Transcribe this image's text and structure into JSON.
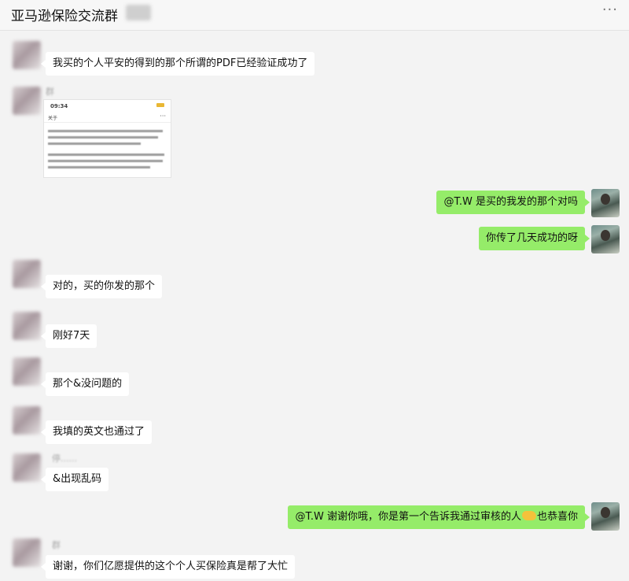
{
  "header": {
    "title": "亚马逊保险交流群",
    "more_icon": "more-icon"
  },
  "messages": {
    "m1": {
      "text": "我买的个人平安的得到的那个所谓的PDF已经验证成功了"
    },
    "m2": {
      "nick": "群",
      "image": {
        "time": "09:34",
        "bar_title": "关于",
        "dots": "···"
      }
    },
    "m3": {
      "text": "@T.W 是买的我发的那个对吗"
    },
    "m4": {
      "text": "你传了几天成功的呀"
    },
    "m5": {
      "text": "对的，买的你发的那个"
    },
    "m6": {
      "text": "刚好7天"
    },
    "m7": {
      "text": "那个&没问题的"
    },
    "m8": {
      "text": "我填的英文也通过了"
    },
    "m9": {
      "nick": "停......",
      "text": "&出现乱码"
    },
    "m10": {
      "text_before": "@T.W 谢谢你哦，你是第一个告诉我通过审核的人",
      "text_after": "也恭喜你"
    },
    "m11": {
      "text": "谢谢，你们亿愿提供的这个个人买保险真是帮了大忙"
    }
  },
  "colors": {
    "outgoing_bubble": "#95ec69",
    "incoming_bubble": "#ffffff",
    "background": "#f3f3f3"
  }
}
